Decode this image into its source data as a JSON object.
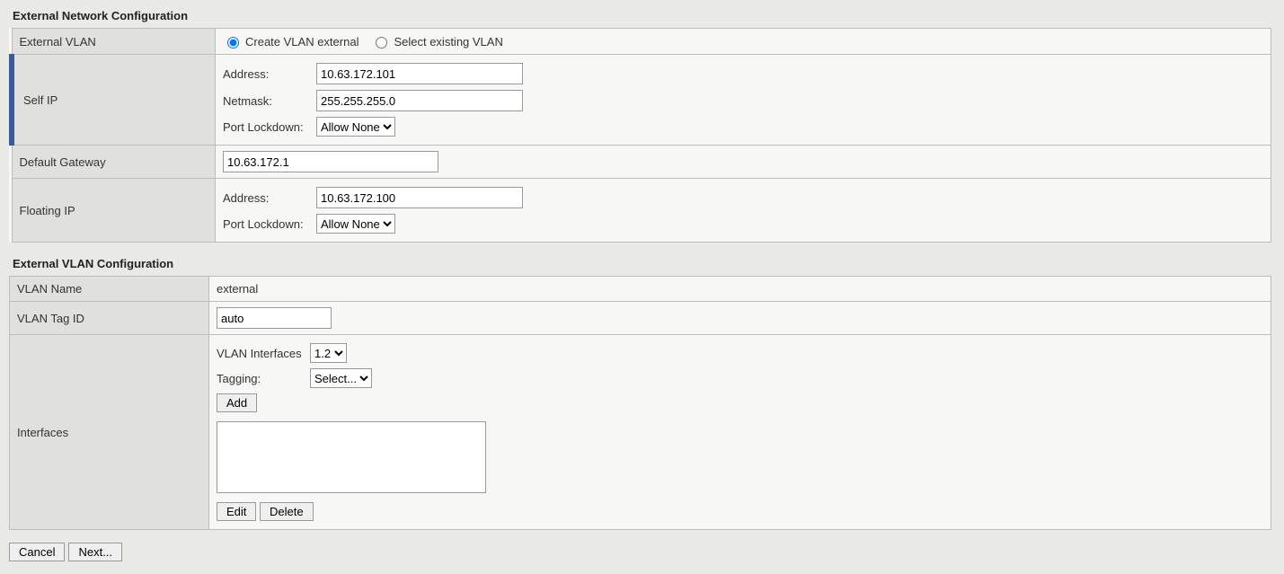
{
  "section1": {
    "title": "External Network Configuration",
    "rows": {
      "external_vlan": {
        "label": "External VLAN",
        "radio_create": "Create VLAN external",
        "radio_select": "Select existing VLAN",
        "checked": "create"
      },
      "self_ip": {
        "label": "Self IP",
        "address_label": "Address:",
        "address_value": "10.63.172.101",
        "netmask_label": "Netmask:",
        "netmask_value": "255.255.255.0",
        "portlock_label": "Port Lockdown:",
        "portlock_value": "Allow None"
      },
      "default_gateway": {
        "label": "Default Gateway",
        "value": "10.63.172.1"
      },
      "floating_ip": {
        "label": "Floating IP",
        "address_label": "Address:",
        "address_value": "10.63.172.100",
        "portlock_label": "Port Lockdown:",
        "portlock_value": "Allow None"
      }
    }
  },
  "section2": {
    "title": "External VLAN Configuration",
    "rows": {
      "vlan_name": {
        "label": "VLAN Name",
        "value": "external"
      },
      "vlan_tag": {
        "label": "VLAN Tag ID",
        "value": "auto"
      },
      "interfaces": {
        "label": "Interfaces",
        "vlan_if_label": "VLAN Interfaces",
        "vlan_if_value": "1.2",
        "tagging_label": "Tagging:",
        "tagging_value": "Select...",
        "add_btn": "Add",
        "edit_btn": "Edit",
        "delete_btn": "Delete"
      }
    }
  },
  "footer": {
    "cancel": "Cancel",
    "next": "Next..."
  }
}
